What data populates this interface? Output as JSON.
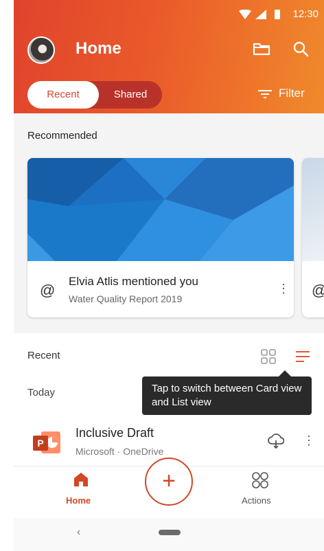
{
  "status_bar": {
    "time": "12:30"
  },
  "header": {
    "title": "Home",
    "tabs": [
      {
        "label": "Recent"
      },
      {
        "label": "Shared"
      }
    ],
    "filter_label": "Filter"
  },
  "recommended": {
    "heading": "Recommended",
    "card": {
      "title": "Elvia Atlis mentioned you",
      "subtitle": "Water Quality Report 2019"
    }
  },
  "recent": {
    "heading": "Recent",
    "group": "Today",
    "tooltip": "Tap to switch between Card view and List view",
    "files": [
      {
        "name": "Inclusive Draft",
        "location": "Microsoft · OneDrive"
      }
    ]
  },
  "bottom_nav": {
    "home_label": "Home",
    "actions_label": "Actions",
    "fab_label": "+"
  },
  "colors": {
    "accent": "#d24726",
    "header_start": "#e0442c",
    "header_end": "#f08a2b",
    "tooltip_bg": "#2a2a2a"
  },
  "icons": [
    "folder-icon",
    "search-icon",
    "filter-icon",
    "at-icon",
    "more-icon",
    "grid-view-icon",
    "list-view-icon",
    "powerpoint-icon",
    "cloud-icon",
    "home-icon",
    "actions-icon"
  ]
}
